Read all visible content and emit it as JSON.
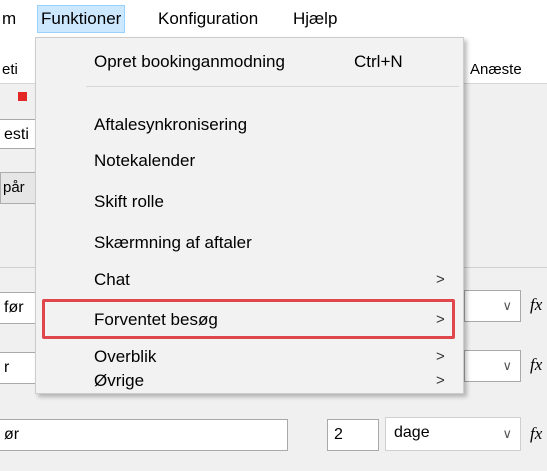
{
  "menubar": {
    "items": [
      "m",
      "Funktioner",
      "Konfiguration",
      "Hjælp"
    ]
  },
  "background": {
    "frag_top_left": "eti",
    "frag_anaest": "Anæste",
    "frag_row2": "esti",
    "frag_row3": "pår",
    "field1_text": "før",
    "field2_text": "r",
    "field3_text": "ør",
    "number_value": "2",
    "combo_unit": "dage",
    "fx_symbol": "fx"
  },
  "menu": {
    "items": [
      {
        "label": "Opret bookinganmodning",
        "shortcut": "Ctrl+N",
        "submenu": false
      },
      {
        "label": "Aftalesynkronisering",
        "submenu": false
      },
      {
        "label": "Notekalender",
        "submenu": false
      },
      {
        "label": "Skift rolle",
        "submenu": false
      },
      {
        "label": "Skærmning af aftaler",
        "submenu": false
      },
      {
        "label": "Chat",
        "submenu": true
      },
      {
        "label": "Forventet besøg",
        "submenu": true,
        "highlighted": true
      },
      {
        "label": "Overblik",
        "submenu": true
      },
      {
        "label": "Øvrige",
        "submenu": true
      }
    ],
    "chevron": ">",
    "highlight_color": "#e0474c"
  },
  "colors": {
    "menubar_active_bg": "#cce8ff",
    "red_marker": "#e32626",
    "blue_marker": "#2b46d8"
  }
}
